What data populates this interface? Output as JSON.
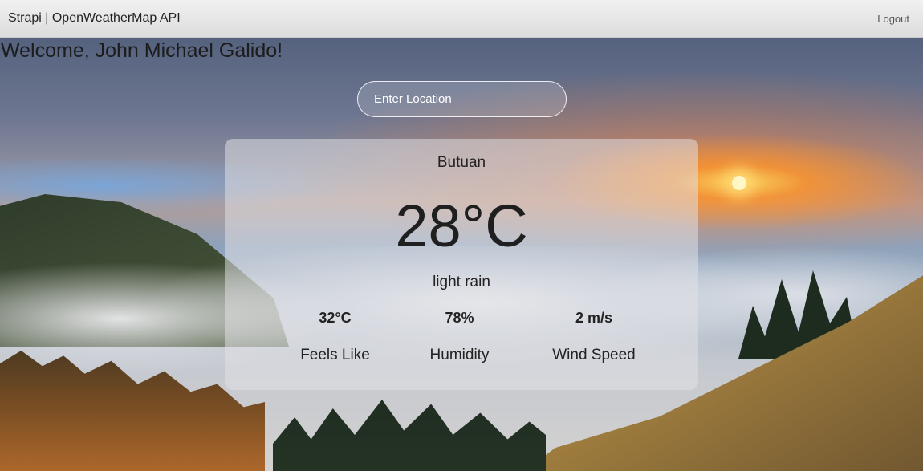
{
  "navbar": {
    "brand": "Strapi | OpenWeatherMap API",
    "logout_label": "Logout"
  },
  "welcome": {
    "text": "Welcome, John Michael Galido!"
  },
  "search": {
    "placeholder": "Enter Location",
    "value": ""
  },
  "weather": {
    "city": "Butuan",
    "temperature": "28°C",
    "description": "light rain",
    "stats": [
      {
        "value": "32°C",
        "label": "Feels Like"
      },
      {
        "value": "78%",
        "label": "Humidity"
      },
      {
        "value": "2 m/s",
        "label": "Wind Speed"
      }
    ]
  },
  "colors": {
    "navbar_bg": "#e6e6e6",
    "card_bg": "#e2e2e6",
    "text": "#222222",
    "sunset_accent": "#ff9a2e"
  }
}
